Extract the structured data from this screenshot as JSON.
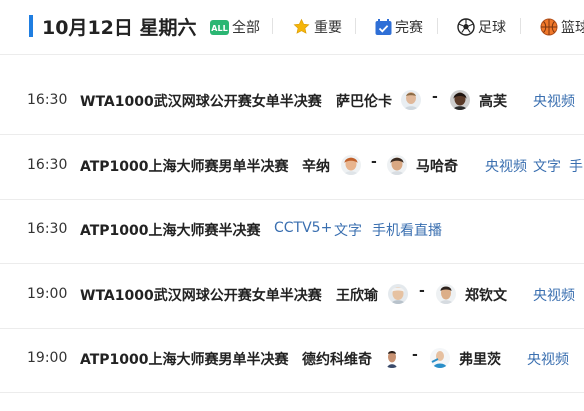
{
  "header": {
    "date": "10月12日 星期六",
    "filters": [
      {
        "label": "全部",
        "badge": "ALL"
      },
      {
        "label": "重要"
      },
      {
        "label": "完赛"
      },
      {
        "label": "足球"
      },
      {
        "label": "篮球"
      }
    ]
  },
  "matches": [
    {
      "time": "16:30",
      "title": "WTA1000武汉网球公开赛女单半决赛",
      "player1": "萨巴伦卡",
      "player2": "高芙",
      "dash": "-",
      "links": [
        "央视频"
      ]
    },
    {
      "time": "16:30",
      "title": "ATP1000上海大师赛男单半决赛",
      "player1": "辛纳",
      "player2": "马哈奇",
      "dash": "-",
      "links": [
        "央视频",
        "文字",
        "手"
      ]
    },
    {
      "time": "16:30",
      "title": "ATP1000上海大师赛半决赛",
      "links": [
        "CCTV5+",
        "文字",
        "手机看直播"
      ]
    },
    {
      "time": "19:00",
      "title": "WTA1000武汉网球公开赛女单半决赛",
      "player1": "王欣瑜",
      "player2": "郑钦文",
      "dash": "-",
      "links": [
        "央视频"
      ]
    },
    {
      "time": "19:00",
      "title": "ATP1000上海大师赛男单半决赛",
      "player1": "德约科维奇",
      "player2": "弗里茨",
      "dash": "-",
      "links": [
        "央视频"
      ]
    }
  ],
  "colors": {
    "accent": "#1f7ee1",
    "link": "#3a6fb0",
    "all_badge": "#2bb673",
    "star": "#f5b50a",
    "done": "#2f6fd6",
    "basketball": "#f0782a"
  },
  "icons": {
    "all": "all-badge-icon",
    "important": "star-icon",
    "finished": "checkbox-icon",
    "football": "soccer-ball-icon",
    "basketball": "basketball-icon"
  }
}
